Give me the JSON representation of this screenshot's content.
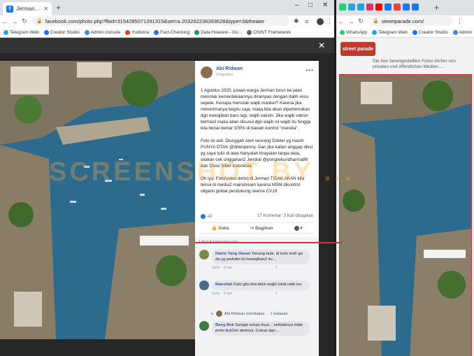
{
  "left_window": {
    "tab_title": "Jerman - 1 Agustus 2020 ...",
    "url": "facebook.com/photo.php?fbid=3154285071291315&set=a.203262236393628&type=3&theater",
    "bookmarks": [
      "Telegram Web",
      "Creator Studio",
      "Admin console",
      "Yudistira",
      "Fact-Checking",
      "Data Hoaxelx - Go...",
      "OSINT Framework"
    ],
    "post": {
      "author": "Abi Ridwan",
      "date": "4 Agustus",
      "paragraphs": [
        "1 Agustus 2020, jutaan warga Jerman turun ke jalan menolak kemerdekaannya dirampas dengan dalih virus sepele. Kenapa menolak wajib masker? Karena jika menerimanya begitu saja, maka kita akan dipertemukan dgn kewajiban baru lagi, wajib vaksin. Jika wajib vaksin berhasil maka akan disusul dgn wajib ini wajib itu hingga kita benar-benar 100% di bawah kontrol \"mereka\".",
        "Foto ini asli. Diunggah oleh seorang Dokter yg masih PUNYA OTAK @drtenpenny. Dan jika kalian anggap diksi yg saya tulis di atas hanyalah khayalan tanpa data, silakan cek unggahan2 Jendral @pongrekundharma88 dan Divisi Siber Indonesia",
        "Oh iya. Foto/video demo di Jerman TIDAK AKAN kita temui di media2 mainstream karena MSM dikontrol oligarki global pendukung skema CV19"
      ],
      "reaction_count": "42",
      "comment_count": "17 Komentar",
      "share_count": "3 Kali dibagikan",
      "like_label": "Suka",
      "share_label": "Bagikan"
    },
    "comments": {
      "more_label": "Lihat 6 komentar lain",
      "items": [
        {
          "name": "Hairie Yang Hasan",
          "text": "Tenang tadz, di indo mah ga da yg peduliin ko kewajiban2 itu ..",
          "like": "Suka",
          "time": "3 hari",
          "count": "1"
        },
        {
          "name": "Manzilah",
          "text": "Kalo gitu kita bikin wajib tolak ratib tes",
          "like": "Suka",
          "time": "3 hari",
          "count": "1"
        },
        {
          "name": "Bang Bek",
          "text": "Sangat setuju kiyai... setidaknya tidak perlu ikut2an aksinya. Cukup dgn...",
          "like": "",
          "time": "",
          "count": ""
        }
      ],
      "reply_label": "Abi Ridwan membalas",
      "reply_count": "1 balasan"
    }
  },
  "right_window": {
    "url": "streetparade.com/",
    "bookmarks": [
      "WhatsApp",
      "Telegram Web",
      "Creator Studio",
      "Admin"
    ],
    "page_text": "Die hier bereitgestellten Fotos dürfen von privaten und öffentlichen Medien ..."
  },
  "watermark": "SCREENSHOT BY ...",
  "colors": {
    "fb_blue": "#385898",
    "accent_red": "#d63031",
    "chrome_tab": "#dee1e6"
  }
}
